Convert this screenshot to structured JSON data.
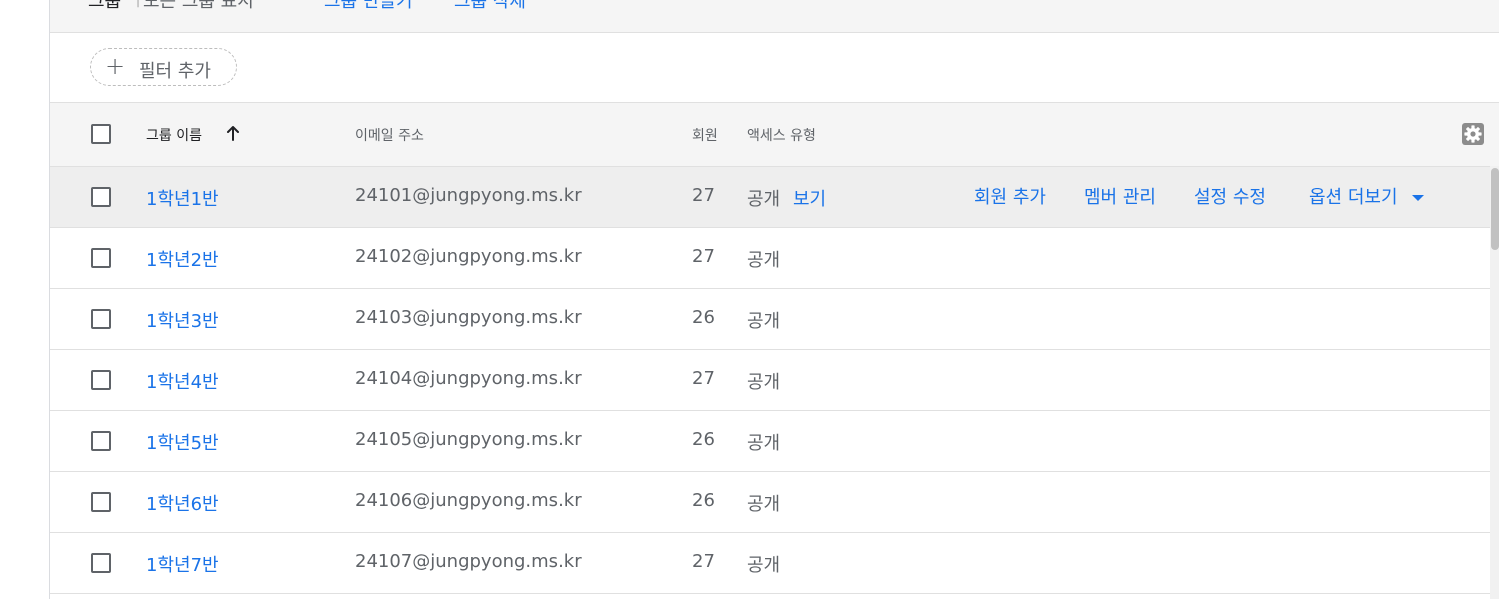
{
  "topbar": {
    "title": "그룹",
    "separator": "|",
    "show_all": "모든 그룹 표시",
    "create_group": "그룹 만들기",
    "delete_group": "그룹 삭제"
  },
  "filter": {
    "add_filter_label": "필터 추가",
    "plus_icon": "+"
  },
  "table": {
    "headers": {
      "group_name": "그룹 이름",
      "email": "이메일 주소",
      "members": "회원",
      "access_type": "액세스 유형"
    },
    "sort": {
      "column": "group_name",
      "direction": "ascending"
    },
    "rows": [
      {
        "name": "1학년1반",
        "email": "24101@jungpyong.ms.kr",
        "members": "27",
        "access": "공개"
      },
      {
        "name": "1학년2반",
        "email": "24102@jungpyong.ms.kr",
        "members": "27",
        "access": "공개"
      },
      {
        "name": "1학년3반",
        "email": "24103@jungpyong.ms.kr",
        "members": "26",
        "access": "공개"
      },
      {
        "name": "1학년4반",
        "email": "24104@jungpyong.ms.kr",
        "members": "27",
        "access": "공개"
      },
      {
        "name": "1학년5반",
        "email": "24105@jungpyong.ms.kr",
        "members": "26",
        "access": "공개"
      },
      {
        "name": "1학년6반",
        "email": "24106@jungpyong.ms.kr",
        "members": "26",
        "access": "공개"
      },
      {
        "name": "1학년7반",
        "email": "24107@jungpyong.ms.kr",
        "members": "27",
        "access": "공개"
      }
    ],
    "hover_row": {
      "view_link": "보기",
      "add_members": "회원 추가",
      "manage_members": "멤버 관리",
      "edit_settings": "설정 수정",
      "more_options": "옵션 더보기"
    }
  },
  "icons": {
    "plus": "plus-icon",
    "sort": "arrow-up-icon",
    "settings": "gear-icon",
    "dropdown": "caret-down-icon"
  },
  "colors": {
    "link": "#1a73e8",
    "header_bg": "#f5f5f5",
    "hover_row_bg": "#eeeeee",
    "text_secondary": "#5f6368"
  }
}
